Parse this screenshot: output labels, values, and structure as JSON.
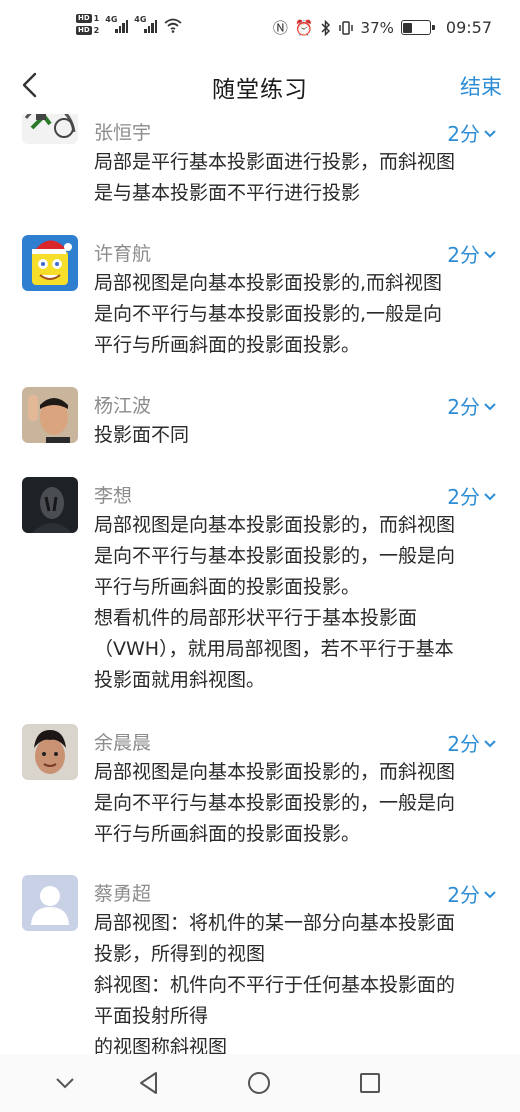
{
  "status_bar": {
    "hd1": "HD",
    "hd1_num": "1",
    "hd2": "HD",
    "hd2_num": "2",
    "sig1": "4G",
    "sig2": "4G",
    "battery_text": "37%",
    "battery_level": 0.37,
    "time": "09:57"
  },
  "nav": {
    "title": "随堂练习",
    "end_label": "结束"
  },
  "answers": [
    {
      "name": "张恒宇",
      "score": "2分",
      "lines": [
        "局部是平行基本投影面进行投影，而斜视图",
        "是与基本投影面不平行进行投影"
      ]
    },
    {
      "name": "许育航",
      "score": "2分",
      "lines": [
        "局部视图是向基本投影面投影的,而斜视图",
        "是向不平行与基本投影面投影的,一般是向",
        "平行与所画斜面的投影面投影。"
      ]
    },
    {
      "name": "杨江波",
      "score": "2分",
      "lines": [
        "投影面不同"
      ]
    },
    {
      "name": "李想",
      "score": "2分",
      "lines": [
        "局部视图是向基本投影面投影的，而斜视图",
        "是向不平行与基本投影面投影的，一般是向",
        "平行与所画斜面的投影面投影。",
        "想看机件的局部形状平行于基本投影面",
        "（VWH），就用局部视图，若不平行于基本",
        "投影面就用斜视图。"
      ]
    },
    {
      "name": "余晨晨",
      "score": "2分",
      "lines": [
        "局部视图是向基本投影面投影的，而斜视图",
        "是向不平行与基本投影面投影的，一般是向",
        "平行与所画斜面的投影面投影。"
      ]
    },
    {
      "name": "蔡勇超",
      "score": "2分",
      "lines": [
        "局部视图：将机件的某一部分向基本投影面",
        "投影，所得到的视图",
        "斜视图：机件向不平行于任何基本投影面的",
        "平面投射所得",
        "的视图称斜视图"
      ]
    }
  ],
  "colors": {
    "accent": "#2d8ed6",
    "name_gray": "#8c8c8c"
  }
}
